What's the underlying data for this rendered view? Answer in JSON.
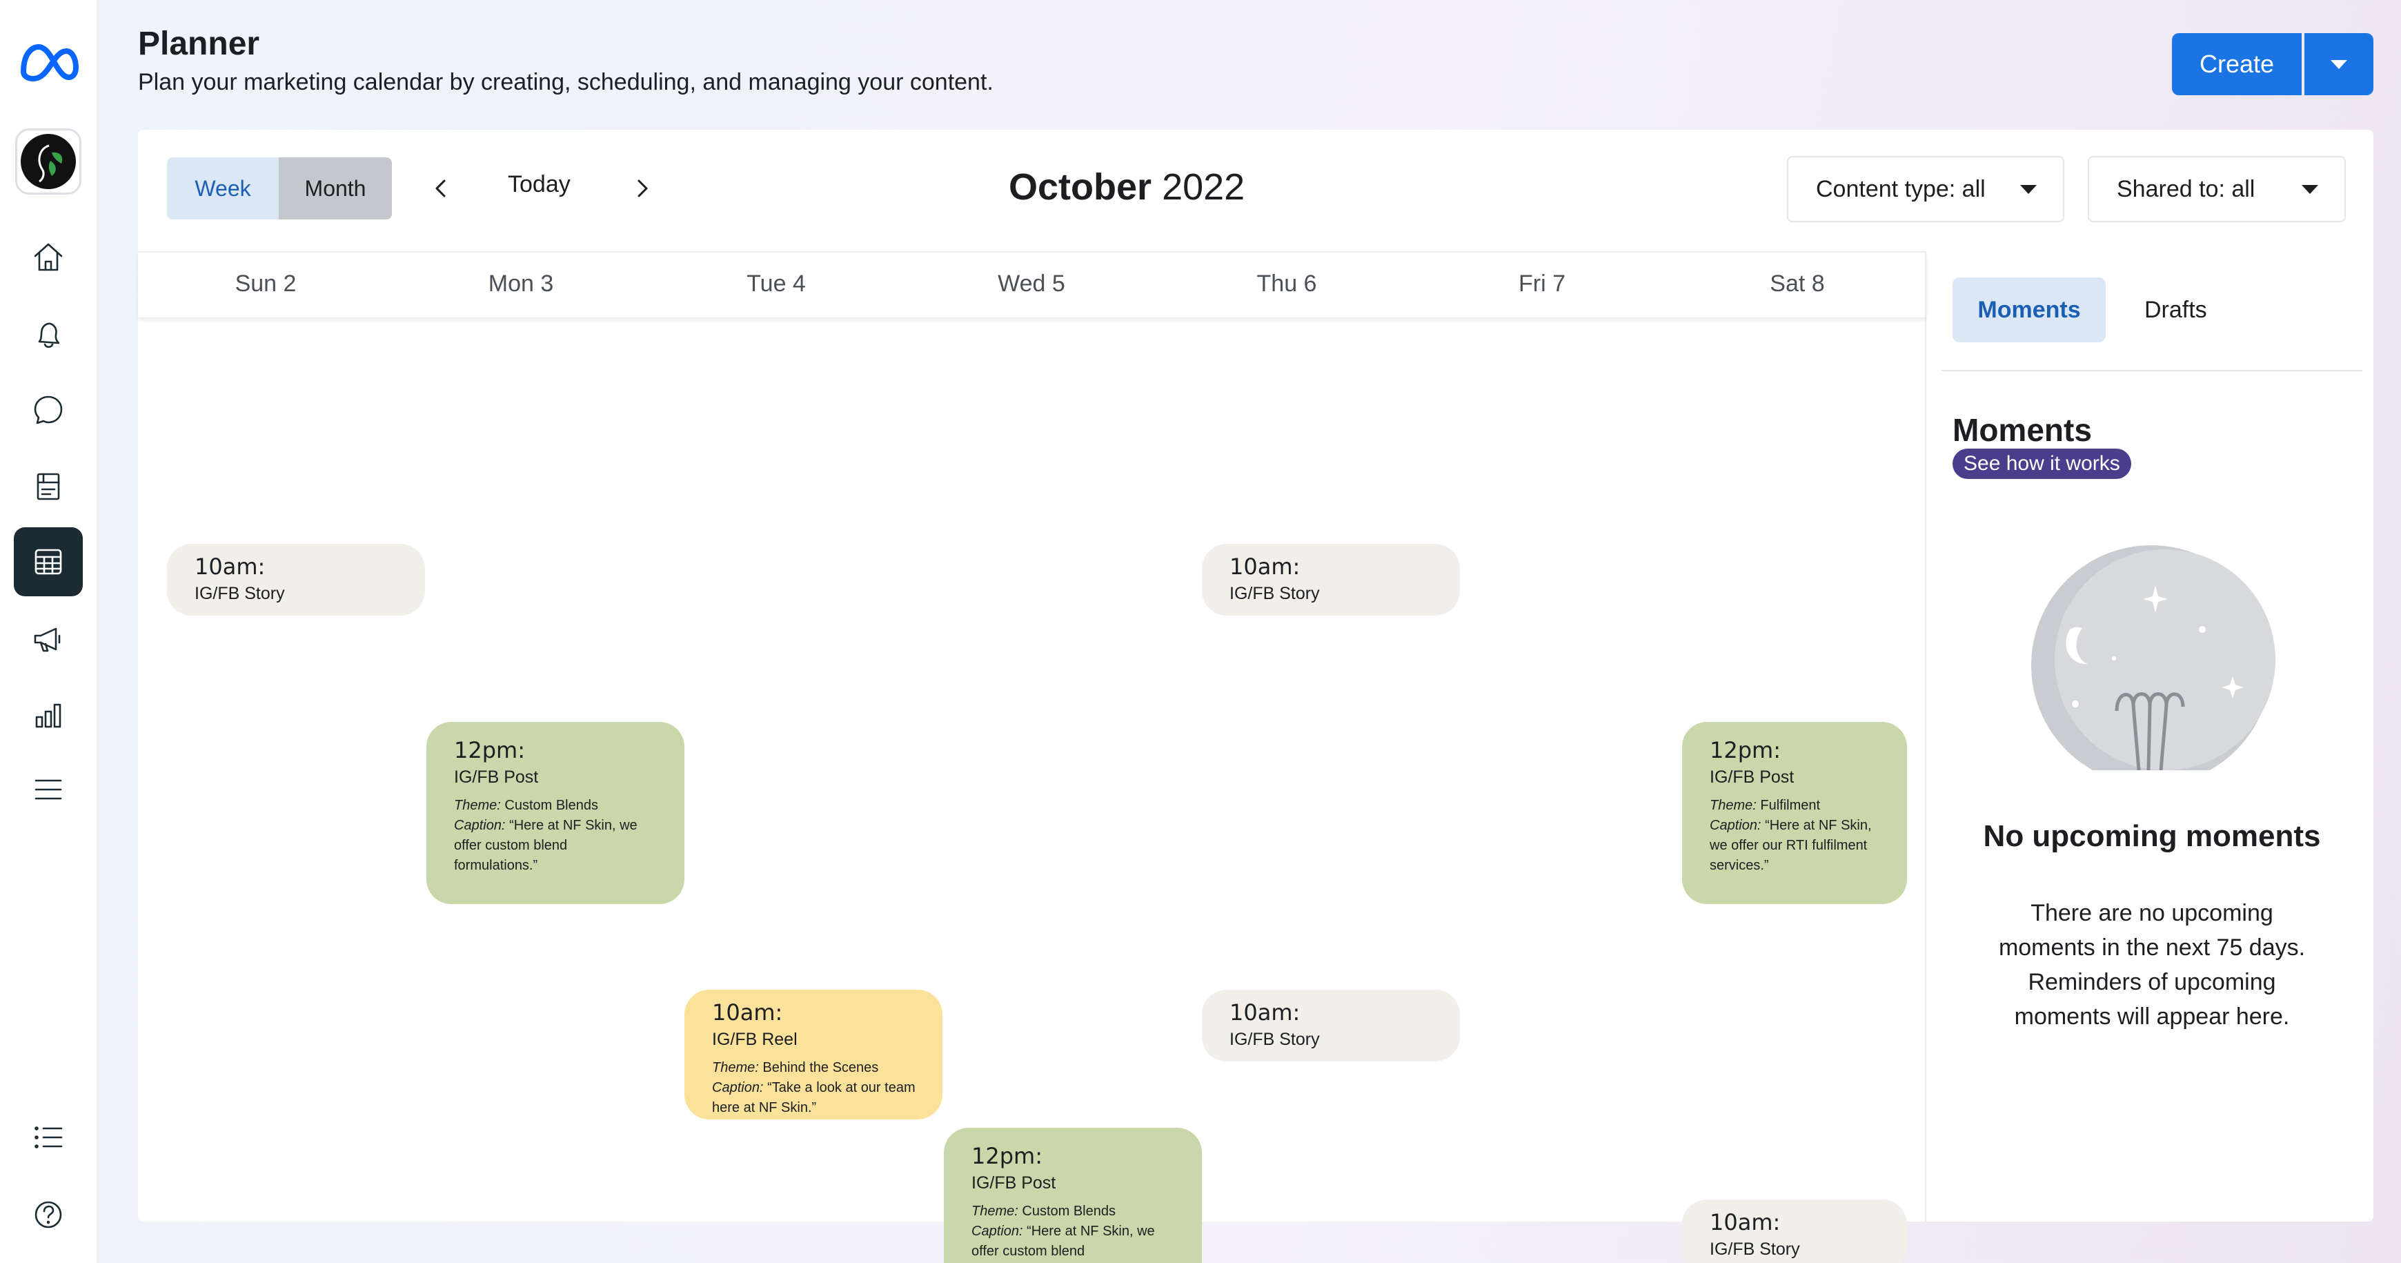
{
  "app": {
    "brand": "Meta"
  },
  "header": {
    "title": "Planner",
    "subtitle": "Plan your marketing calendar by creating, scheduling, and managing your content.",
    "create_label": "Create"
  },
  "sidebar": {
    "items": [
      {
        "icon": "home-icon"
      },
      {
        "icon": "bell-icon"
      },
      {
        "icon": "chat-bubble-icon"
      },
      {
        "icon": "content-icon"
      },
      {
        "icon": "calendar-grid-icon",
        "active": true
      },
      {
        "icon": "megaphone-icon"
      },
      {
        "icon": "bar-chart-icon"
      },
      {
        "icon": "menu-icon"
      },
      {
        "icon": "list-icon"
      },
      {
        "icon": "help-icon"
      }
    ]
  },
  "toolbar": {
    "week_label": "Week",
    "month_label": "Month",
    "today_label": "Today",
    "month_name": "October",
    "year": "2022",
    "content_type_filter": "Content type: all",
    "shared_to_filter": "Shared to: all"
  },
  "calendar": {
    "days": [
      "Sun 2",
      "Mon 3",
      "Tue 4",
      "Wed 5",
      "Thu 6",
      "Fri 7",
      "Sat 8"
    ],
    "events": [
      {
        "day": "Sun 2",
        "time": "10am:",
        "type": "IG/FB Story"
      },
      {
        "day": "Thu 6",
        "time": "10am:",
        "type": "IG/FB Story"
      },
      {
        "day": "Mon 3",
        "time": "12pm:",
        "type": "IG/FB Post",
        "theme_label": "Theme:",
        "theme": "Custom Blends",
        "caption_label": "Caption:",
        "caption": "“Here at NF Skin, we offer custom blend formulations.”"
      },
      {
        "day": "Sat 8",
        "time": "12pm:",
        "type": "IG/FB Post",
        "theme_label": "Theme:",
        "theme": "Fulfilment",
        "caption_label": "Caption:",
        "caption": "“Here at NF Skin, we offer our RTI fulfilment services.”"
      },
      {
        "day": "Tue 4",
        "time": "10am:",
        "type": "IG/FB Reel",
        "theme_label": "Theme:",
        "theme": "Behind the Scenes",
        "caption_label": "Caption:",
        "caption": "“Take a look at our team here at NF Skin.”"
      },
      {
        "day": "Thu 6",
        "time": "10am:",
        "type": "IG/FB Story"
      },
      {
        "day": "Wed 5",
        "time": "12pm:",
        "type": "IG/FB Post",
        "theme_label": "Theme:",
        "theme": "Custom Blends",
        "caption_label": "Caption:",
        "caption": "“Here at NF Skin, we offer custom blend formulations.”"
      },
      {
        "day": "Sat 8",
        "time": "10am:",
        "type": "IG/FB Story"
      }
    ]
  },
  "side_panel": {
    "tabs": [
      "Moments",
      "Drafts"
    ],
    "heading": "Moments",
    "see_how_label": "See how it works",
    "empty_title": "No upcoming moments",
    "empty_text": "There are no upcoming moments in the next 75 days. Reminders of upcoming moments will appear here."
  },
  "colors": {
    "accent": "#1b74e4",
    "story": "#f2efea",
    "post": "#c9d8aa",
    "reel": "#fae29b",
    "badge": "#4a3d8c"
  }
}
